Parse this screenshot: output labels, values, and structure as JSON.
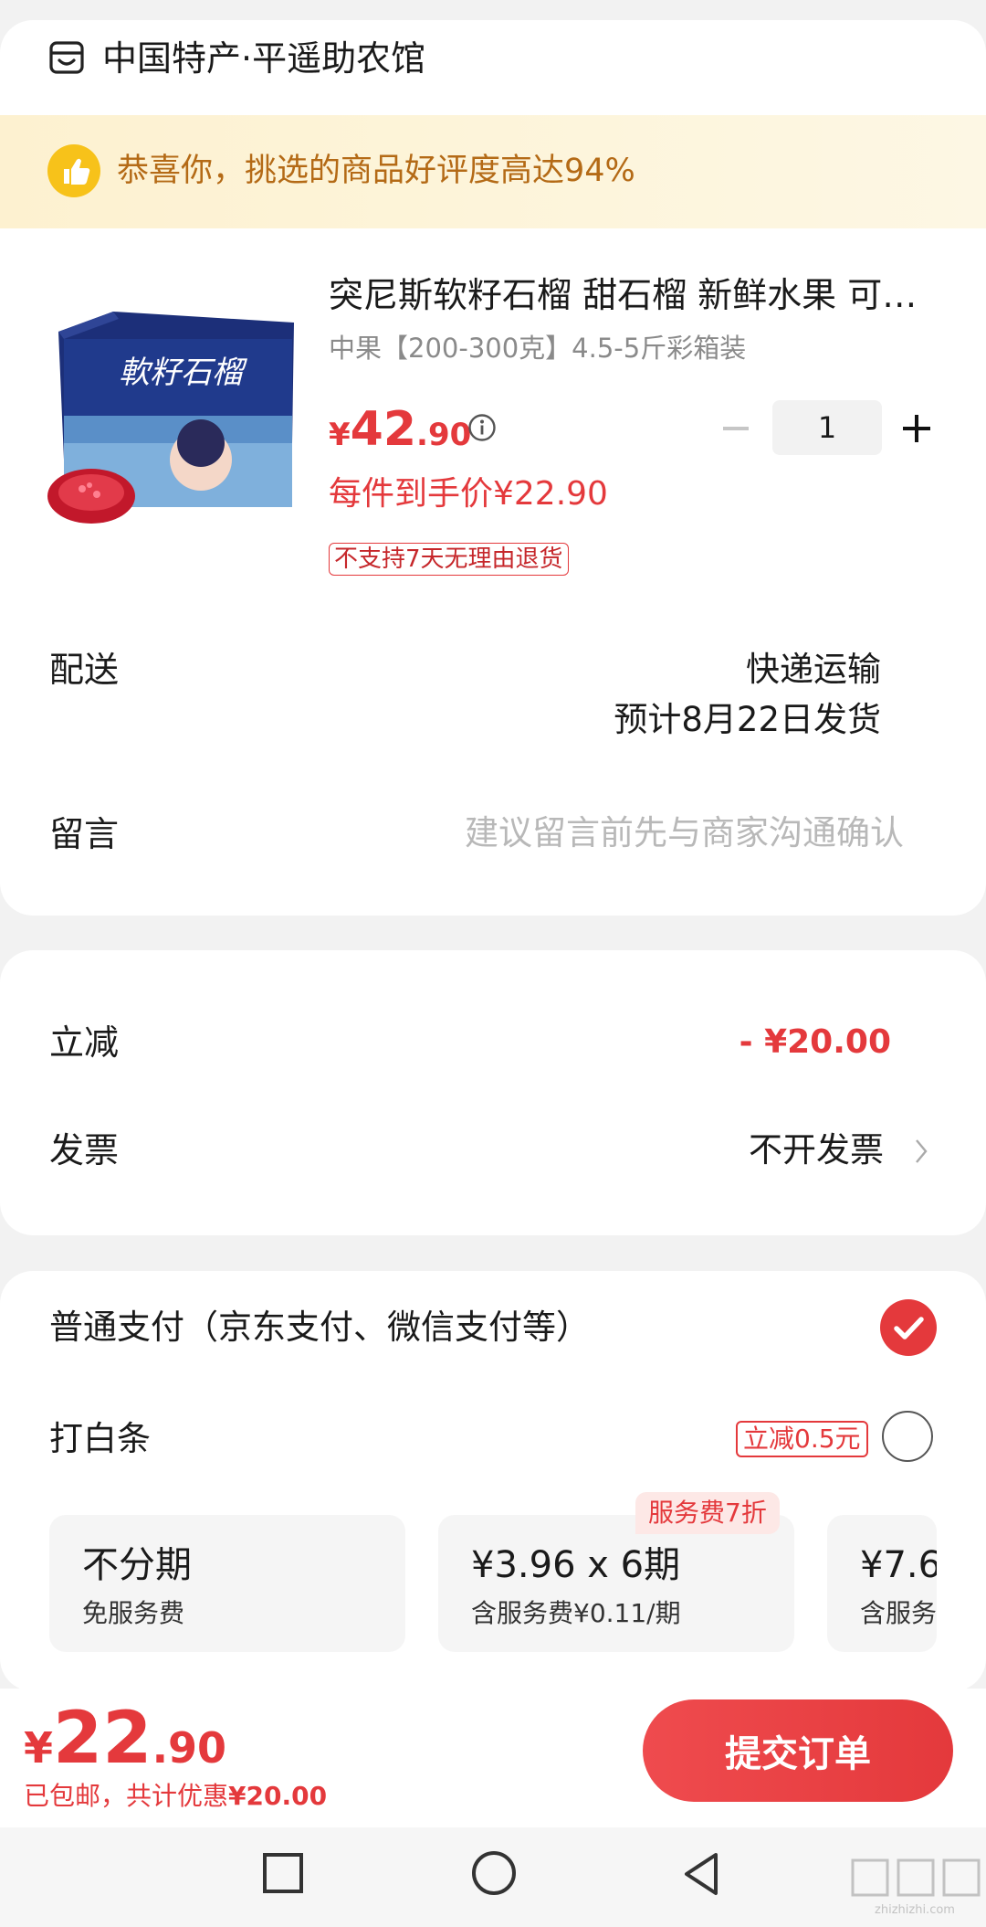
{
  "store": {
    "name": "中国特产·平遥助农馆",
    "icon": "store-icon"
  },
  "banner": {
    "text": "恭喜你，挑选的商品好评度高达94%",
    "icon": "thumbs-up-icon"
  },
  "product": {
    "title": "突尼斯软籽石榴 甜石榴 新鲜水果 可…",
    "spec": "中果【200-300克】4.5-5斤彩箱装",
    "price_currency": "¥",
    "price_int": "42",
    "price_dec": ".90",
    "per_item_price": "每件到手价¥22.90",
    "return_policy": "不支持7天无理由退货",
    "box_text": "軟籽石榴",
    "quantity": "1"
  },
  "delivery": {
    "label": "配送",
    "method": "快递运输",
    "eta": "预计8月22日发货"
  },
  "message": {
    "label": "留言",
    "placeholder": "建议留言前先与商家沟通确认",
    "value": ""
  },
  "discount": {
    "label": "立减",
    "value": "- ¥20.00"
  },
  "invoice": {
    "label": "发票",
    "value": "不开发票"
  },
  "payment": {
    "option1_label": "普通支付（京东支付、微信支付等）",
    "option1_selected": true,
    "option2_label": "打白条",
    "option2_promo": "立减0.5元",
    "option2_selected": false,
    "installments": [
      {
        "title": "不分期",
        "sub": "免服务费"
      },
      {
        "title": "¥3.96 x 6期",
        "sub": "含服务费¥0.11/期",
        "tag": "服务费7折"
      },
      {
        "title": "¥7.6",
        "sub": "含服务"
      }
    ]
  },
  "footer": {
    "total_currency": "¥",
    "total_int": "22",
    "total_dec": ".90",
    "note_prefix": "已包邮，共计优惠",
    "note_amount": "¥20.00",
    "submit_label": "提交订单"
  },
  "watermark": {
    "text": "zhizhizhi.com"
  },
  "colors": {
    "accent": "#e4393c",
    "banner_text": "#b46a16",
    "banner_bg": "#fdf3d6",
    "page_bg": "#f2f2f2"
  }
}
